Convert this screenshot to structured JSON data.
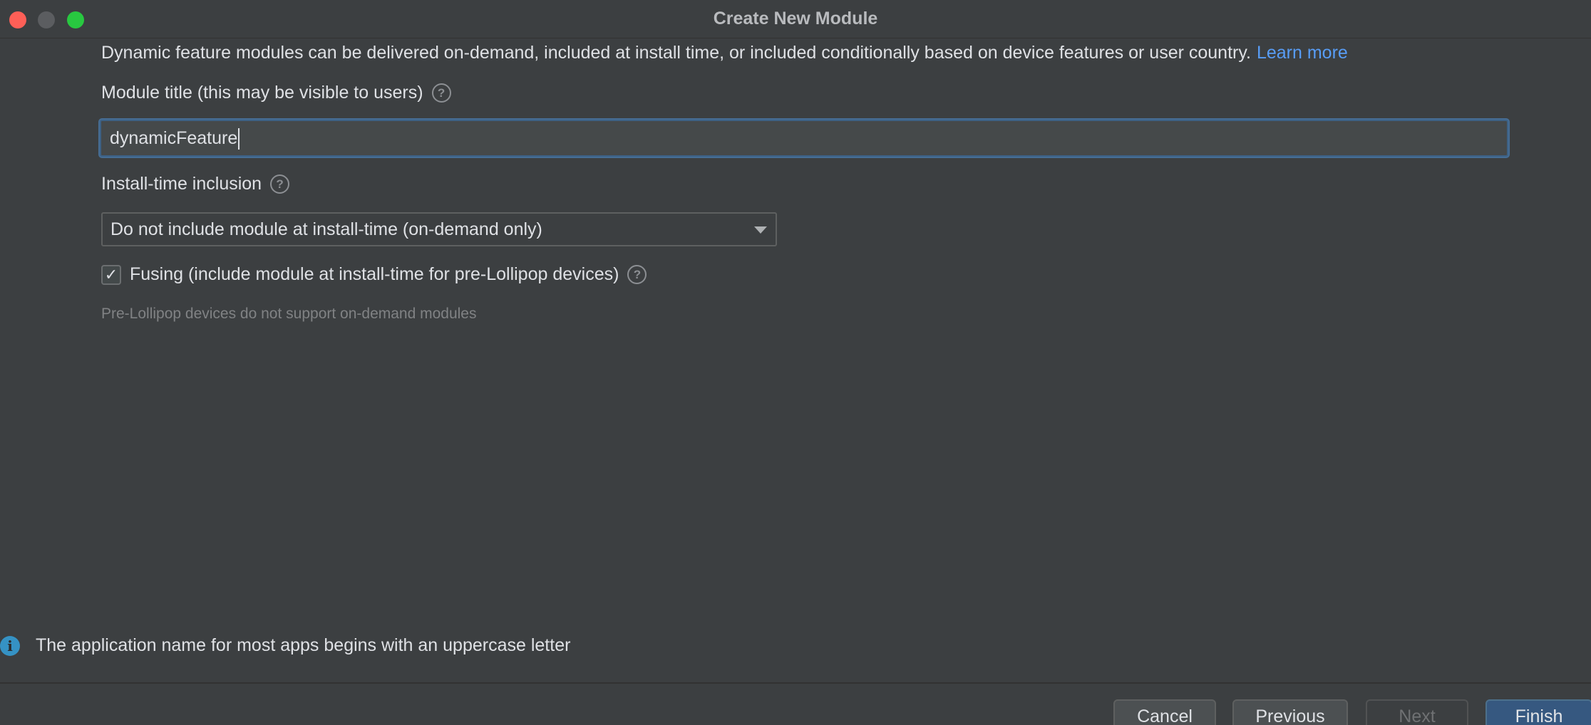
{
  "window": {
    "title": "Create New Module"
  },
  "description": {
    "text": "Dynamic feature modules can be delivered on-demand, included at install time, or included conditionally based on device features or user country.",
    "link": "Learn more"
  },
  "module_title": {
    "label": "Module title (this may be visible to users)",
    "value": "dynamicFeature"
  },
  "install_time": {
    "label": "Install-time inclusion",
    "selected": "Do not include module at install-time (on-demand only)"
  },
  "fusing": {
    "label": "Fusing (include module at install-time for pre-Lollipop devices)",
    "checked": true,
    "check_glyph": "✓"
  },
  "hint": "Pre-Lollipop devices do not support on-demand modules",
  "info_message": "The application name for most apps begins with an uppercase letter",
  "help_glyph": "?",
  "info_glyph": "i",
  "footer": {
    "cancel": "Cancel",
    "previous": "Previous",
    "next": "Next",
    "finish": "Finish"
  }
}
